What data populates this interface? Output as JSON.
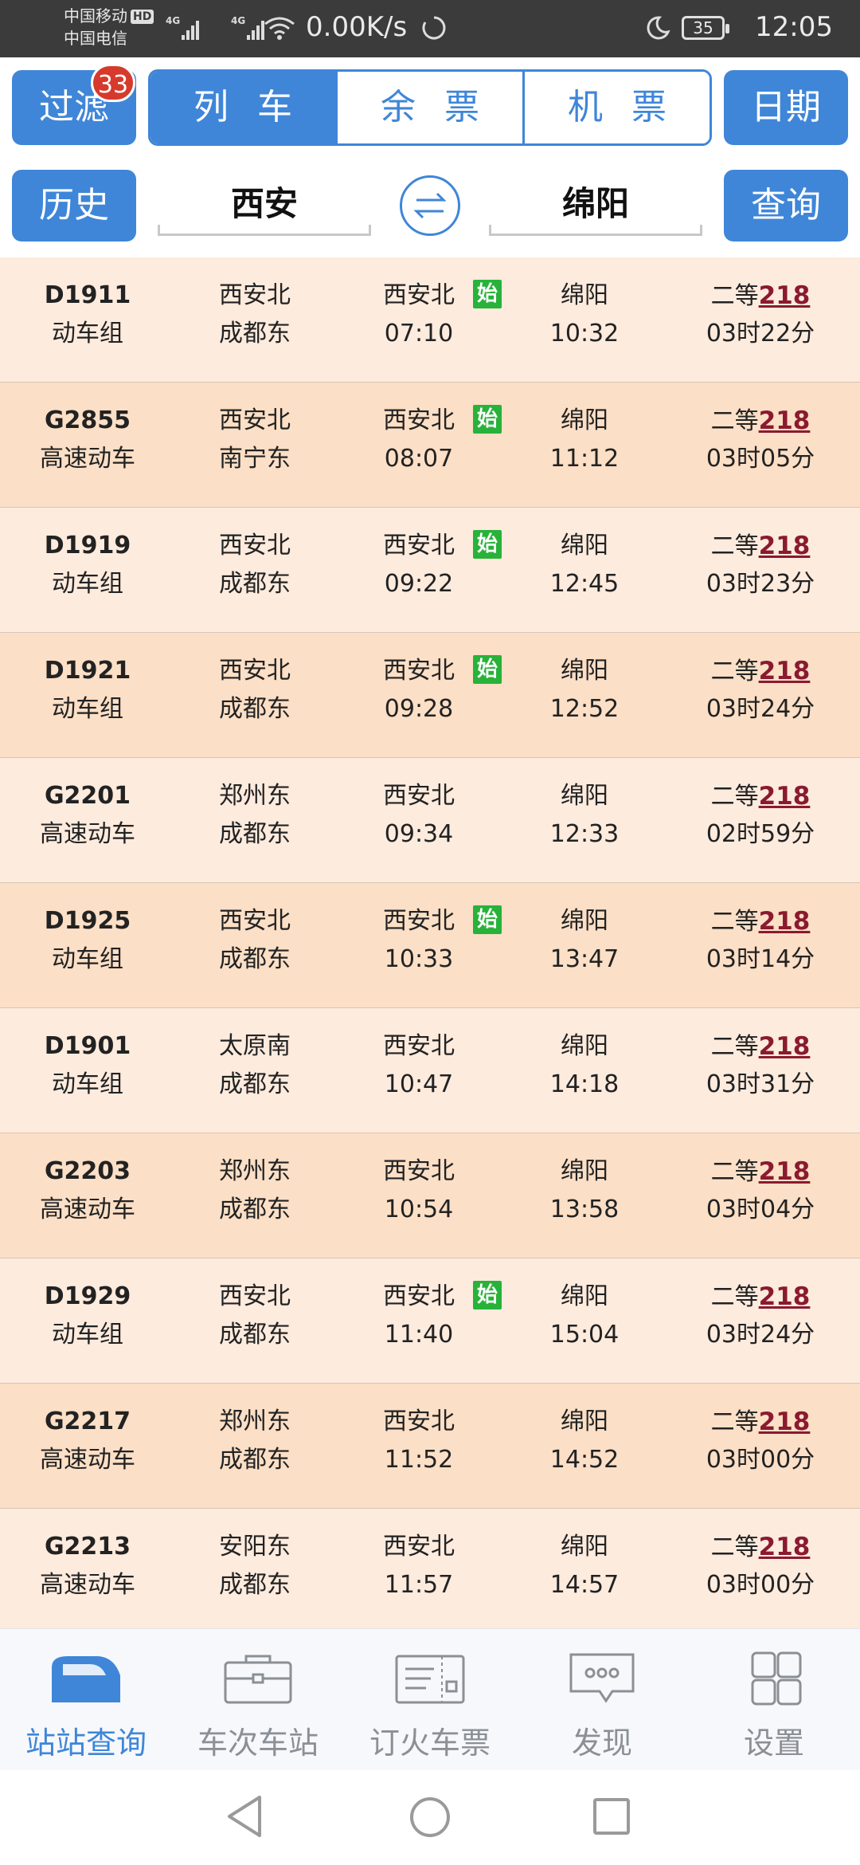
{
  "status_bar": {
    "carrier1": "中国移动",
    "hd": "HD",
    "carrier2": "中国电信",
    "net1": "4G",
    "net2": "4G",
    "speed": "0.00K/s",
    "battery": "35",
    "time": "12:05"
  },
  "toolbar": {
    "filter_label": "过滤",
    "filter_badge": "33",
    "tabs": [
      {
        "label": "列车",
        "active": true
      },
      {
        "label": "余票",
        "active": false
      },
      {
        "label": "机票",
        "active": false
      }
    ],
    "date_label": "日期"
  },
  "search": {
    "history_label": "历史",
    "from_station": "西安",
    "to_station": "绵阳",
    "query_label": "查询"
  },
  "trains": [
    {
      "number": "D1911",
      "type": "动车组",
      "origin": "西安北",
      "terminus": "成都东",
      "depart_station": "西安北",
      "depart_time": "07:10",
      "arrive_station": "绵阳",
      "arrive_time": "10:32",
      "seat_class": "二等",
      "remaining": "218",
      "duration": "03时22分",
      "is_origin": true
    },
    {
      "number": "G2855",
      "type": "高速动车",
      "origin": "西安北",
      "terminus": "南宁东",
      "depart_station": "西安北",
      "depart_time": "08:07",
      "arrive_station": "绵阳",
      "arrive_time": "11:12",
      "seat_class": "二等",
      "remaining": "218",
      "duration": "03时05分",
      "is_origin": true
    },
    {
      "number": "D1919",
      "type": "动车组",
      "origin": "西安北",
      "terminus": "成都东",
      "depart_station": "西安北",
      "depart_time": "09:22",
      "arrive_station": "绵阳",
      "arrive_time": "12:45",
      "seat_class": "二等",
      "remaining": "218",
      "duration": "03时23分",
      "is_origin": true
    },
    {
      "number": "D1921",
      "type": "动车组",
      "origin": "西安北",
      "terminus": "成都东",
      "depart_station": "西安北",
      "depart_time": "09:28",
      "arrive_station": "绵阳",
      "arrive_time": "12:52",
      "seat_class": "二等",
      "remaining": "218",
      "duration": "03时24分",
      "is_origin": true
    },
    {
      "number": "G2201",
      "type": "高速动车",
      "origin": "郑州东",
      "terminus": "成都东",
      "depart_station": "西安北",
      "depart_time": "09:34",
      "arrive_station": "绵阳",
      "arrive_time": "12:33",
      "seat_class": "二等",
      "remaining": "218",
      "duration": "02时59分",
      "is_origin": false
    },
    {
      "number": "D1925",
      "type": "动车组",
      "origin": "西安北",
      "terminus": "成都东",
      "depart_station": "西安北",
      "depart_time": "10:33",
      "arrive_station": "绵阳",
      "arrive_time": "13:47",
      "seat_class": "二等",
      "remaining": "218",
      "duration": "03时14分",
      "is_origin": true
    },
    {
      "number": "D1901",
      "type": "动车组",
      "origin": "太原南",
      "terminus": "成都东",
      "depart_station": "西安北",
      "depart_time": "10:47",
      "arrive_station": "绵阳",
      "arrive_time": "14:18",
      "seat_class": "二等",
      "remaining": "218",
      "duration": "03时31分",
      "is_origin": false
    },
    {
      "number": "G2203",
      "type": "高速动车",
      "origin": "郑州东",
      "terminus": "成都东",
      "depart_station": "西安北",
      "depart_time": "10:54",
      "arrive_station": "绵阳",
      "arrive_time": "13:58",
      "seat_class": "二等",
      "remaining": "218",
      "duration": "03时04分",
      "is_origin": false
    },
    {
      "number": "D1929",
      "type": "动车组",
      "origin": "西安北",
      "terminus": "成都东",
      "depart_station": "西安北",
      "depart_time": "11:40",
      "arrive_station": "绵阳",
      "arrive_time": "15:04",
      "seat_class": "二等",
      "remaining": "218",
      "duration": "03时24分",
      "is_origin": true
    },
    {
      "number": "G2217",
      "type": "高速动车",
      "origin": "郑州东",
      "terminus": "成都东",
      "depart_station": "西安北",
      "depart_time": "11:52",
      "arrive_station": "绵阳",
      "arrive_time": "14:52",
      "seat_class": "二等",
      "remaining": "218",
      "duration": "03时00分",
      "is_origin": false
    },
    {
      "number": "G2213",
      "type": "高速动车",
      "origin": "安阳东",
      "terminus": "成都东",
      "depart_station": "西安北",
      "depart_time": "11:57",
      "arrive_station": "绵阳",
      "arrive_time": "14:57",
      "seat_class": "二等",
      "remaining": "218",
      "duration": "03时00分",
      "is_origin": false
    }
  ],
  "origin_badge": "始",
  "bottom_nav": [
    {
      "label": "站站查询",
      "icon": "train-icon",
      "active": true
    },
    {
      "label": "车次车站",
      "icon": "briefcase-icon",
      "active": false
    },
    {
      "label": "订火车票",
      "icon": "ticket-icon",
      "active": false
    },
    {
      "label": "发现",
      "icon": "chat-bubble-icon",
      "active": false
    },
    {
      "label": "设置",
      "icon": "grid-icon",
      "active": false
    }
  ],
  "colors": {
    "accent": "#3f86d8",
    "row_light": "#fdebde",
    "row_dark": "#fbdfc6",
    "price": "#8a1a2f",
    "origin_badge": "#28b239",
    "filter_badge": "#d63a2c"
  }
}
